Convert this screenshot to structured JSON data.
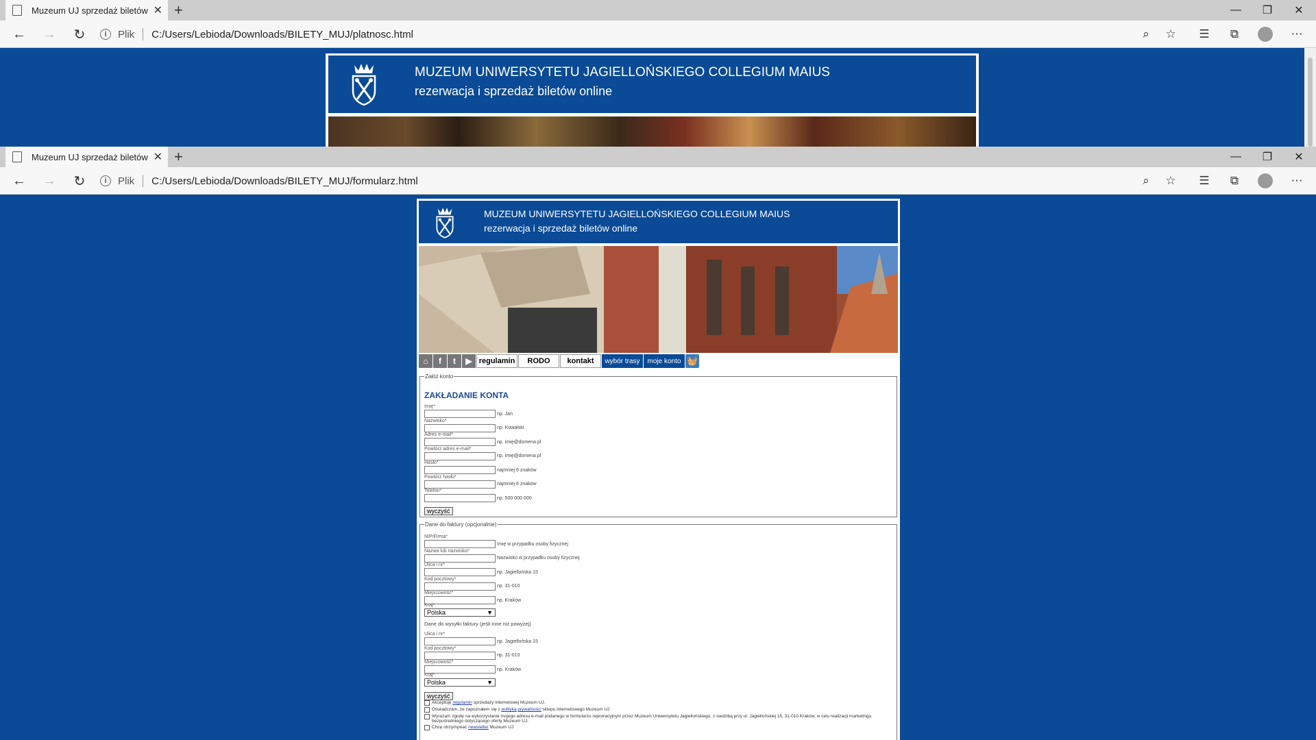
{
  "window1": {
    "tab_title": "Muzeum UJ sprzedaż biletów on",
    "plik_label": "Plik",
    "url": "C:/Users/Lebioda/Downloads/BILETY_MUJ/platnosc.html",
    "header_title": "MUZEUM UNIWERSYTETU JAGIELLOŃSKIEGO COLLEGIUM MAIUS",
    "header_subtitle": "rezerwacja i sprzedaż biletów online"
  },
  "window2": {
    "tab_title": "Muzeum UJ sprzedaż biletów on",
    "plik_label": "Plik",
    "url": "C:/Users/Lebioda/Downloads/BILETY_MUJ/formularz.html",
    "header_title": "MUZEUM UNIWERSYTETU JAGIELLOŃSKIEGO COLLEGIUM MAIUS",
    "header_subtitle": "rezerwacja i sprzedaż biletów online"
  },
  "nav": {
    "regulamin": "regulamin",
    "rodo": "RODO",
    "kontakt": "kontakt",
    "wybor": "wybór trasy",
    "konto": "moje konto"
  },
  "account": {
    "legend": "Załóż konto",
    "heading": "ZAKŁADANIE KONTA",
    "fields": [
      {
        "label": "Imię*",
        "hint": "np. Jan"
      },
      {
        "label": "Nazwisko*",
        "hint": "np. Kowalski"
      },
      {
        "label": "Adres e-mail*",
        "hint": "np. imię@domena.pl"
      },
      {
        "label": "Powtórz adres e-mail*",
        "hint": "np. imię@domena.pl"
      },
      {
        "label": "Hasło*",
        "hint": "najmniej 6 znaków"
      },
      {
        "label": "Powtórz hasło*",
        "hint": "najmniej 6 znaków"
      },
      {
        "label": "Telefon*",
        "hint": "np. 500 000 000"
      }
    ],
    "clear": "wyczyść"
  },
  "invoice": {
    "legend": "Dane do faktury (opcjonalnie)",
    "fields": [
      {
        "label": "NIP/Firma*",
        "hint": "Imię w przypadku osoby fizycznej"
      },
      {
        "label": "Nazwa lub nazwisko*",
        "hint": "Nazwisko w przypadku osoby fizycznej"
      },
      {
        "label": "Ulica i nr*",
        "hint": "np. Jagiellońska 15"
      },
      {
        "label": "Kod pocztowy*",
        "hint": "np. 31-010"
      },
      {
        "label": "Miejscowość*",
        "hint": "np. Kraków"
      }
    ],
    "country_label": "Kraj*",
    "country_value": "Polska",
    "shipping_note": "Dane do wysyłki faktury (jeśli inne niż powyżej)",
    "shipping_fields": [
      {
        "label": "Ulica i nr*",
        "hint": "np. Jagiellońska 15"
      },
      {
        "label": "Kod pocztowy*",
        "hint": "np. 31-010"
      },
      {
        "label": "Miejscowość*",
        "hint": "np. Kraków"
      }
    ],
    "country2_label": "Kraj*",
    "country2_value": "Polska",
    "clear": "wyczyść"
  },
  "consents": {
    "c1_pre": "Akceptuję ",
    "c1_link": "regulamin",
    "c1_post": " sprzedaży internetowej Muzeum UJ.",
    "c2_pre": "Oświadczam, że zapoznałem się z ",
    "c2_link1": "polityką",
    "c2_mid": " ",
    "c2_link2": "prywatności",
    "c2_post": " sklepu internetowego Muzeum UJ",
    "c3": "Wyrażam zgodę na wykorzystanie mojego adresu e-mail podanego w formularzu rejestracyjnym przez Muzeum Uniwersytetu Jagiellońskiego, z siedzibą przy ul. Jagiellońskiej 15, 31-010 Kraków, w celu realizacji marketingu bezpośredniego dotyczącego oferty Muzeum UJ.",
    "c4_pre": "Chcę otrzymywać ",
    "c4_link": "newsletter",
    "c4_post": " Muzeum UJ"
  },
  "colors": {
    "brand_blue": "#0a4a96"
  }
}
